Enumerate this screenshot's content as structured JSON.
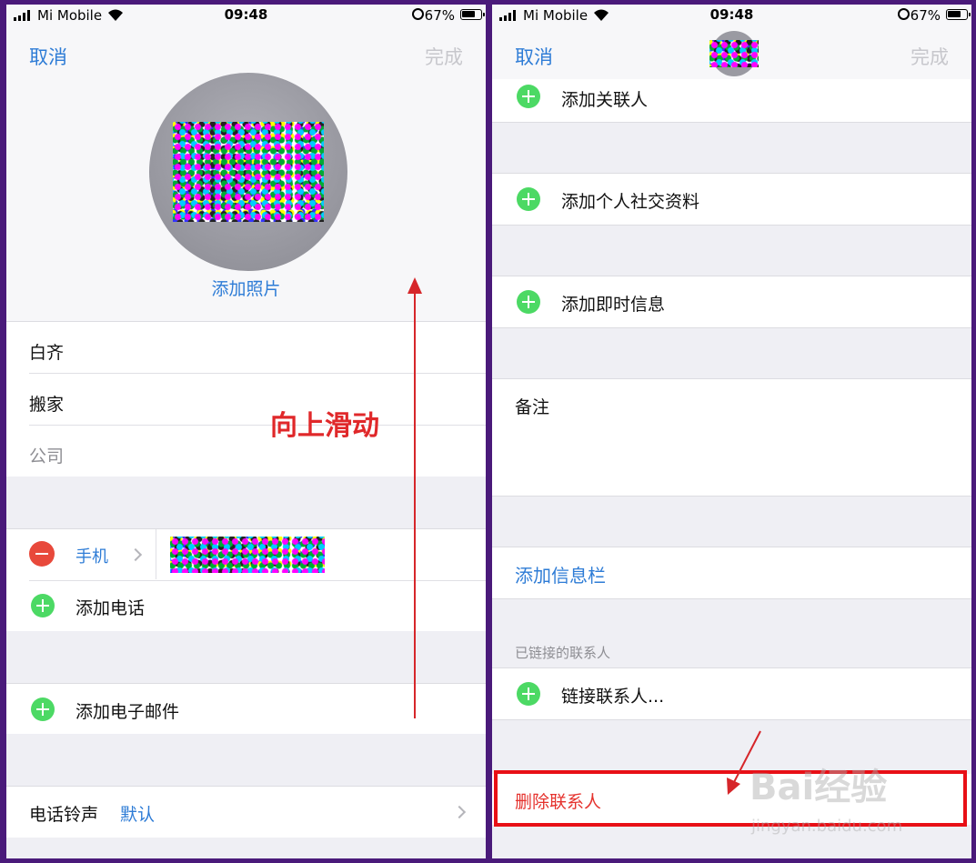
{
  "left": {
    "status": {
      "carrier": "Mi Mobile",
      "time": "09:48",
      "battery": "67%"
    },
    "nav": {
      "cancel": "取消",
      "done": "完成"
    },
    "add_photo": "添加照片",
    "name_fields": [
      "白齐",
      "搬家"
    ],
    "company_placeholder": "公司",
    "phone_label": "手机",
    "add_phone": "添加电话",
    "add_email": "添加电子邮件",
    "ringtone_label": "电话铃声",
    "ringtone_value": "默认",
    "annotation": "向上滑动"
  },
  "right": {
    "status": {
      "carrier": "Mi Mobile",
      "time": "09:48",
      "battery": "67%"
    },
    "nav": {
      "cancel": "取消",
      "done": "完成"
    },
    "add_related": "添加关联人",
    "add_social": "添加个人社交资料",
    "add_im": "添加即时信息",
    "notes_label": "备注",
    "add_field": "添加信息栏",
    "linked_header": "已链接的联系人",
    "link_contact": "链接联系人...",
    "delete_contact": "删除联系人",
    "watermark": "Bai经验",
    "watermark_url": "jingyan.baidu.com"
  },
  "colors": {
    "accent": "#2e7cd6",
    "add_green": "#4cd964",
    "remove_red": "#e8493b",
    "annotation_red": "#e0282a",
    "frame": "#4a1a7a"
  }
}
